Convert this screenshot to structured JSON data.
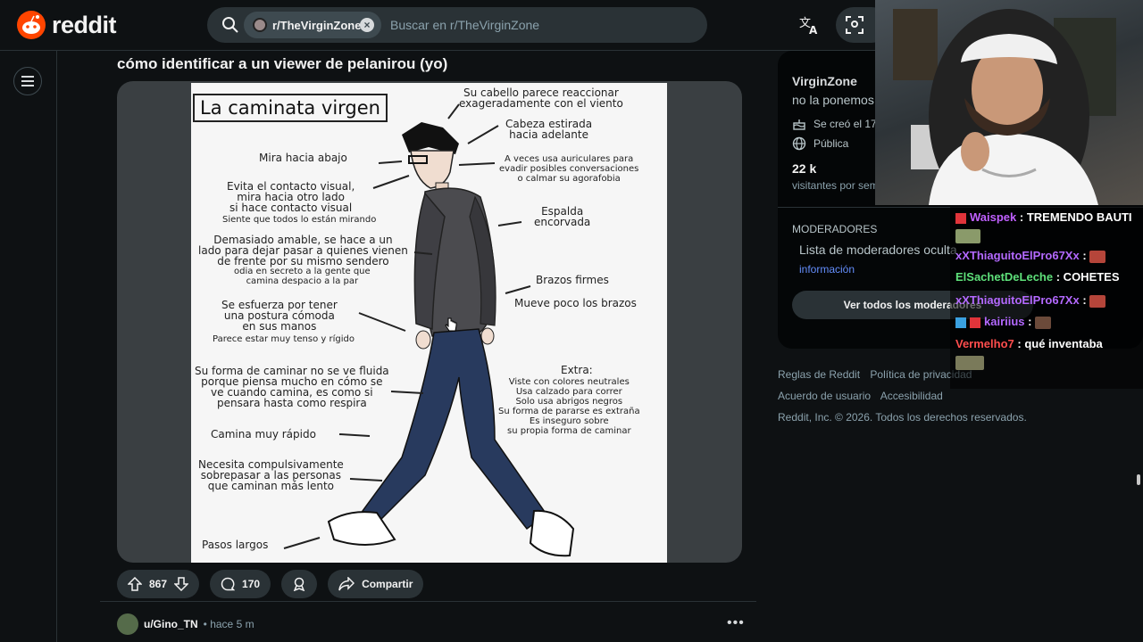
{
  "header": {
    "brand": "reddit",
    "search_chip": "r/TheVirginZone",
    "search_placeholder": "Buscar en r/TheVirginZone"
  },
  "post": {
    "title": "cómo identificar a un viewer de pelanirou (yo)",
    "image": {
      "heading": "La caminata virgen",
      "labels": {
        "hair": "Su cabello parece reaccionar\nexageradamente con el viento",
        "head": "Cabeza estirada\nhacia adelante",
        "look_down": "Mira hacia abajo",
        "headphones": "A veces usa auriculares para\nevadir posibles conversaciones\no calmar su agorafobia",
        "avoid_contact": "Evita el contacto visual,\nmira hacia otro lado\nsi hace contacto visual",
        "avoid_contact_sub": "Siente que todos lo están mirando",
        "back": "Espalda\nencorvada",
        "kind": "Demasiado amable, se hace a un\nlado para dejar pasar a quienes vienen\nde frente por su mismo sendero",
        "kind_sub": "odia en secreto a la gente que\ncamina despacio a la par",
        "arms": "Brazos firmes",
        "arms2": "Mueve poco los brazos",
        "posture": "Se esfuerza por tener\nuna postura cómoda\nen sus manos",
        "posture_sub": "Parece estar muy tenso y rígido",
        "walk": "Su forma de caminar no se ve fluida\nporque piensa mucho en cómo se\nve cuando camina, es como si\npensara hasta como respira",
        "extra": "Extra:",
        "extra_list": "Viste con colores neutrales\nUsa calzado para correr\nSolo usa abrigos negros\nSu forma de pararse es extraña\nEs inseguro sobre\nsu propia forma de caminar",
        "fast": "Camina muy rápido",
        "overtake": "Necesita compulsivamente\nsobrepasar a las personas\nque caminan más lento",
        "steps": "Pasos largos"
      }
    },
    "votes": "867",
    "comments": "170",
    "share_label": "Compartir"
  },
  "comment": {
    "author": "u/Gino_TN",
    "time": "• hace 5 m"
  },
  "sidebar": {
    "name": "VirginZone",
    "description": "no la ponemos",
    "created": "Se creó el 17",
    "visibility": "Pública",
    "visitors": "22 k",
    "visitors_label": "visitantes por sem",
    "mods_heading": "MODERADORES",
    "mods_text": "Lista de moderadores oculta",
    "info_link": "información",
    "view_mods_button": "Ver todos los moderadores"
  },
  "footer": {
    "links_row1": [
      "Reglas de Reddit",
      "Política de privacidad"
    ],
    "links_row2": [
      "Acuerdo de usuario",
      "Accesibilidad"
    ],
    "copyright": "Reddit, Inc. © 2026. Todos los derechos reservados."
  },
  "overlay_chat": [
    {
      "user": "Waispek",
      "color": "#c060ff",
      "text": ": TREMENDO BAUTI"
    },
    {
      "user": "",
      "color": "#ffffff",
      "text": ""
    },
    {
      "user": "xXThiaguitoElPro67Xx",
      "color": "#b469ff",
      "text": ":"
    },
    {
      "user": "ElSachetDeLeche",
      "color": "#5ee07a",
      "text": ": COHETES"
    },
    {
      "user": "xXThiaguitoElPro67Xx",
      "color": "#b469ff",
      "text": ":"
    },
    {
      "user": "kairiius",
      "color": "#b469ff",
      "text": ":"
    },
    {
      "user": "Vermelho7",
      "color": "#ff4d4d",
      "text": ": qué inventaba"
    }
  ],
  "colors": {
    "bg": "#0e1113",
    "accent_orange": "#ff4500",
    "link_blue": "#648efc"
  }
}
